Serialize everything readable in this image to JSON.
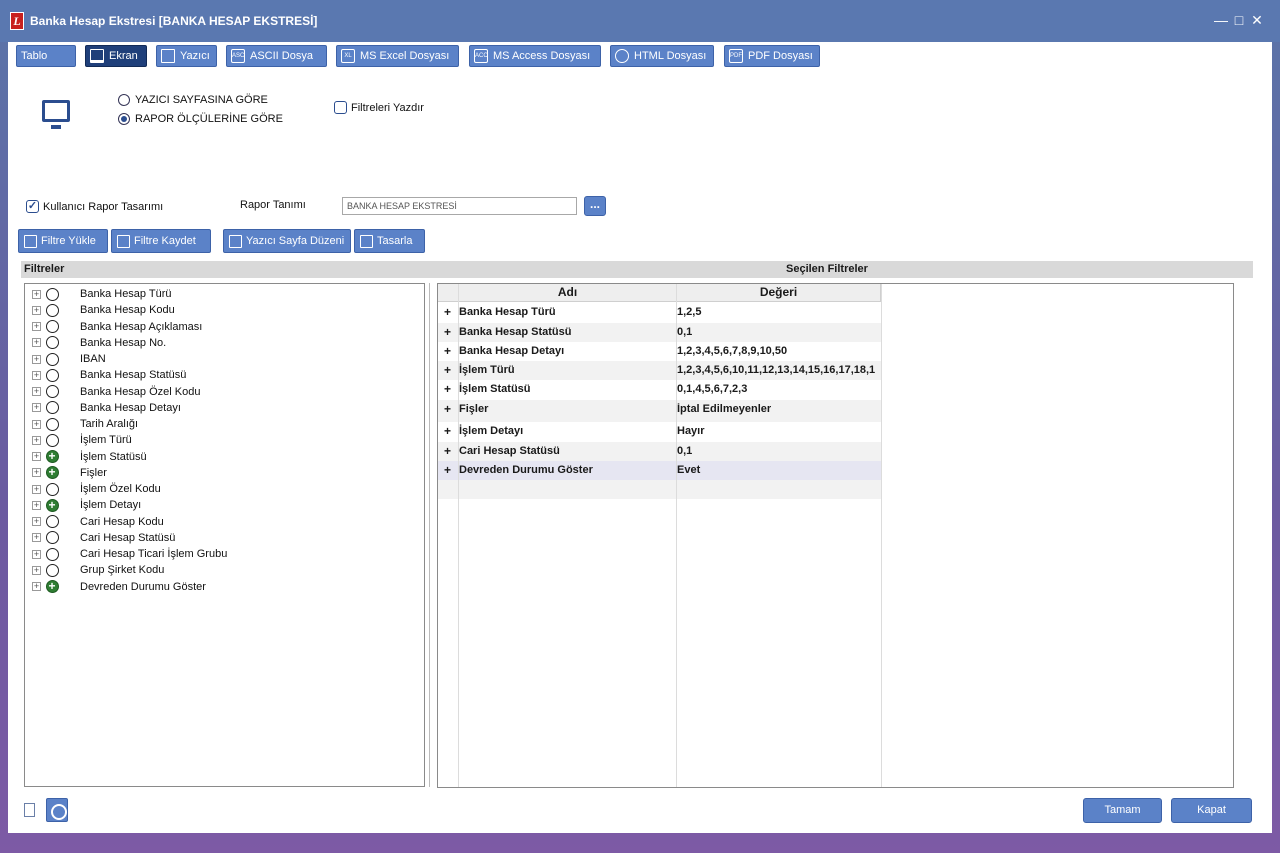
{
  "window": {
    "title": "Banka Hesap Ekstresi [BANKA HESAP EKSTRESİ]",
    "logo": "L"
  },
  "tabs": [
    {
      "label": "Tablo",
      "icon": "table-icon"
    },
    {
      "label": "Ekran",
      "icon": "monitor-icon",
      "active": true
    },
    {
      "label": "Yazıcı",
      "icon": "printer-icon"
    },
    {
      "label": "ASCII Dosya",
      "icon": "ascii-file-icon"
    },
    {
      "label": "MS Excel Dosyası",
      "icon": "excel-file-icon"
    },
    {
      "label": "MS Access Dosyası",
      "icon": "access-file-icon"
    },
    {
      "label": "HTML Dosyası",
      "icon": "html-globe-icon"
    },
    {
      "label": "PDF Dosyası",
      "icon": "pdf-file-icon"
    }
  ],
  "options": {
    "radio_printer_page": "YAZICI SAYFASINA GÖRE",
    "radio_report_size": "RAPOR ÖLÇÜLERİNE GÖRE",
    "selected": "radio_report_size",
    "print_filters": "Filtreleri Yazdır",
    "print_filters_checked": false,
    "user_report_design": "Kullanıcı Rapor Tasarımı",
    "user_report_design_checked": true,
    "report_def_label": "Rapor Tanımı",
    "report_def_value": "BANKA HESAP EKSTRESİ",
    "browse": "..."
  },
  "actions": {
    "load_filter": "Filtre Yükle",
    "save_filter": "Filtre Kaydet",
    "page_setup": "Yazıcı Sayfa Düzeni",
    "design": "Tasarla"
  },
  "filters_title": "Filtreler",
  "selected_filters_title": "Seçilen Filtreler",
  "filters": [
    {
      "label": "Banka Hesap Türü",
      "active": false
    },
    {
      "label": "Banka Hesap Kodu",
      "active": false
    },
    {
      "label": "Banka Hesap Açıklaması",
      "active": false
    },
    {
      "label": "Banka Hesap No.",
      "active": false
    },
    {
      "label": "IBAN",
      "active": false
    },
    {
      "label": "Banka Hesap Statüsü",
      "active": false
    },
    {
      "label": "Banka Hesap Özel Kodu",
      "active": false
    },
    {
      "label": "Banka Hesap Detayı",
      "active": false
    },
    {
      "label": "Tarih Aralığı",
      "active": false
    },
    {
      "label": "İşlem Türü",
      "active": false
    },
    {
      "label": "İşlem Statüsü",
      "active": true
    },
    {
      "label": "Fişler",
      "active": true
    },
    {
      "label": "İşlem Özel Kodu",
      "active": false
    },
    {
      "label": "İşlem Detayı",
      "active": true
    },
    {
      "label": "Cari Hesap Kodu",
      "active": false
    },
    {
      "label": "Cari Hesap Statüsü",
      "active": false
    },
    {
      "label": "Cari Hesap Ticari İşlem Grubu",
      "active": false
    },
    {
      "label": "Grup Şirket Kodu",
      "active": false
    },
    {
      "label": "Devreden Durumu Göster",
      "active": true
    }
  ],
  "grid": {
    "col_name": "Adı",
    "col_value": "Değeri",
    "rows": [
      {
        "plus": "+",
        "name": "Banka Hesap Türü",
        "value": "1,2,5"
      },
      {
        "plus": "+",
        "name": "Banka Hesap Statüsü",
        "value": "0,1"
      },
      {
        "plus": "+",
        "name": "Banka Hesap Detayı",
        "value": "1,2,3,4,5,6,7,8,9,10,50"
      },
      {
        "plus": "+",
        "name": "İşlem Türü",
        "value": "1,2,3,4,5,6,10,11,12,13,14,15,16,17,18,1"
      },
      {
        "plus": "+",
        "name": "İşlem Statüsü",
        "value": "0,1,4,5,6,7,2,3"
      },
      {
        "plus": "+",
        "name": "Fişler",
        "value": "İptal Edilmeyenler"
      },
      {
        "plus": "+",
        "name": "İşlem Detayı",
        "value": "Hayır"
      },
      {
        "plus": "+",
        "name": "Cari Hesap Statüsü",
        "value": "0,1"
      },
      {
        "plus": "+",
        "name": "Devreden Durumu Göster",
        "value": "Evet"
      }
    ]
  },
  "footer": {
    "ok": "Tamam",
    "close": "Kapat"
  }
}
